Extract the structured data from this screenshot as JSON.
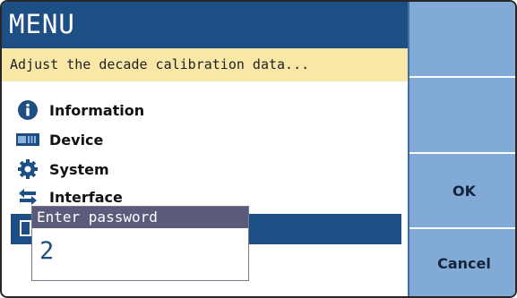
{
  "header": {
    "title": "MENU"
  },
  "hint": {
    "text": "Adjust the decade calibration data..."
  },
  "menu": {
    "items": [
      {
        "label": "Information",
        "icon": "info-icon"
      },
      {
        "label": "Device",
        "icon": "device-icon"
      },
      {
        "label": "System",
        "icon": "gear-icon"
      },
      {
        "label": "Interface",
        "icon": "arrows-icon"
      },
      {
        "label": "",
        "icon": "calibration-icon"
      }
    ]
  },
  "softkeys": {
    "ok": "OK",
    "cancel": "Cancel"
  },
  "password_dialog": {
    "title": "Enter password",
    "value": "2"
  },
  "colors": {
    "title_bar": "#1e4f84",
    "hint_bar": "#f8e7a6",
    "softkey": "#82aad6",
    "dialog_header": "#5b5b7b"
  }
}
